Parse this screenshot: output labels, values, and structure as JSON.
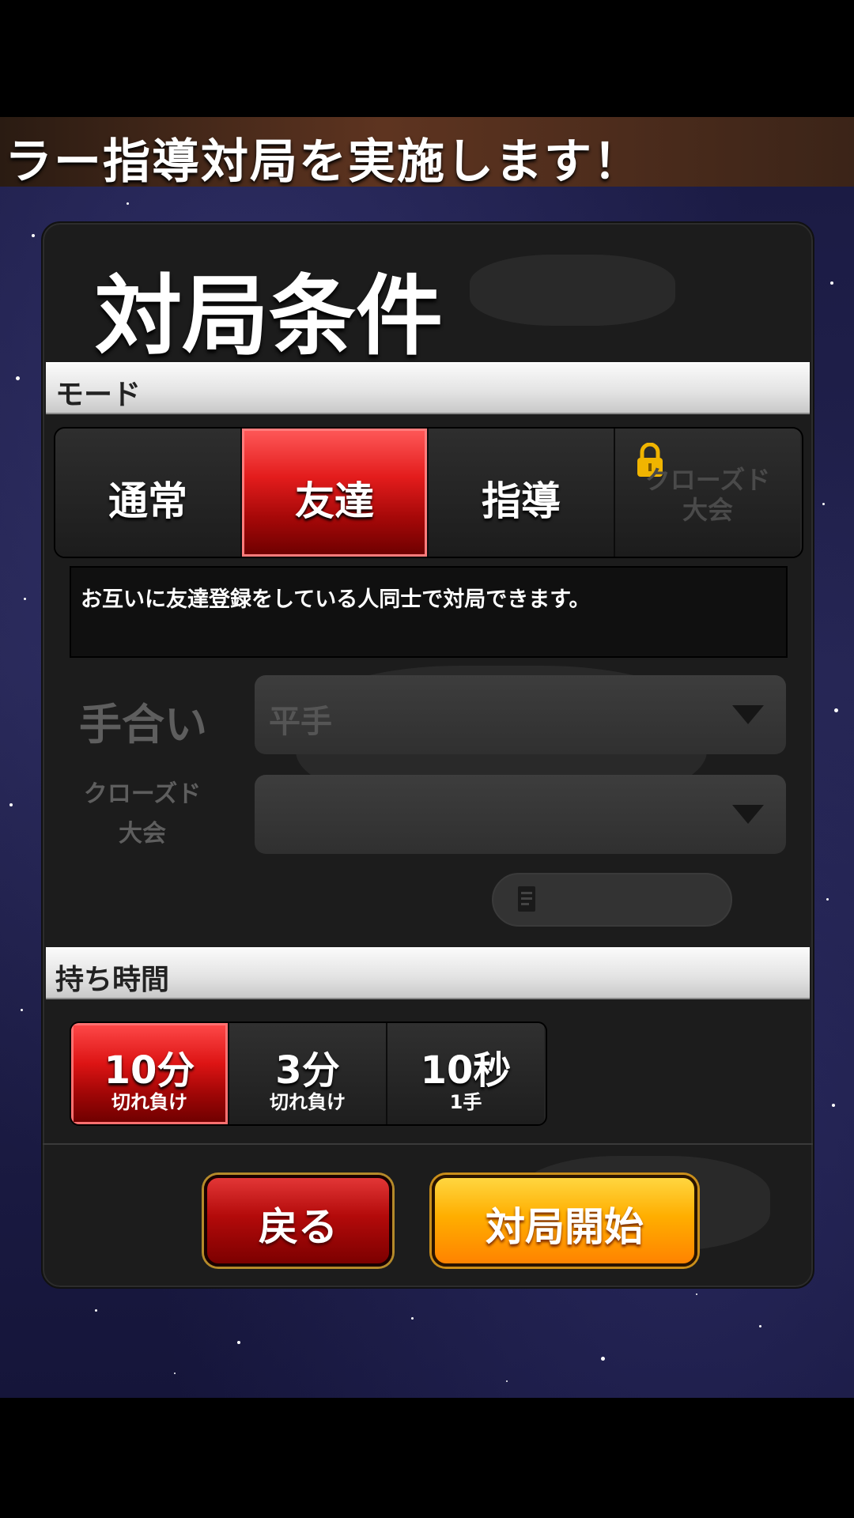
{
  "banner": {
    "text": "ラー指導対局を実施します！"
  },
  "panel": {
    "title": "対局条件",
    "mode_section": {
      "label": "モード",
      "options": [
        {
          "label": "通常",
          "active": false,
          "locked": false
        },
        {
          "label": "友達",
          "active": true,
          "locked": false
        },
        {
          "label": "指導",
          "active": false,
          "locked": false
        },
        {
          "label": "クローズド\n大会",
          "active": false,
          "locked": true
        }
      ],
      "description": "お互いに友達登録をしている人同士で対局できます。"
    },
    "handicap": {
      "label": "手合い",
      "value": "平手"
    },
    "closed_tournament": {
      "label": "クローズド\n大会",
      "value": ""
    },
    "time_section": {
      "label": "持ち時間",
      "options": [
        {
          "main": "10分",
          "sub": "切れ負け",
          "active": true
        },
        {
          "main": "3分",
          "sub": "切れ負け",
          "active": false
        },
        {
          "main": "10秒",
          "sub": "1手",
          "active": false
        }
      ]
    },
    "buttons": {
      "back": "戻る",
      "start": "対局開始"
    }
  },
  "icons": {
    "lock": "lock-icon",
    "note": "note-icon",
    "caret": "chevron-down-icon"
  },
  "colors": {
    "active_red": "#e31c1c",
    "start_orange": "#ffae00",
    "lock_gold": "#f0b400"
  }
}
